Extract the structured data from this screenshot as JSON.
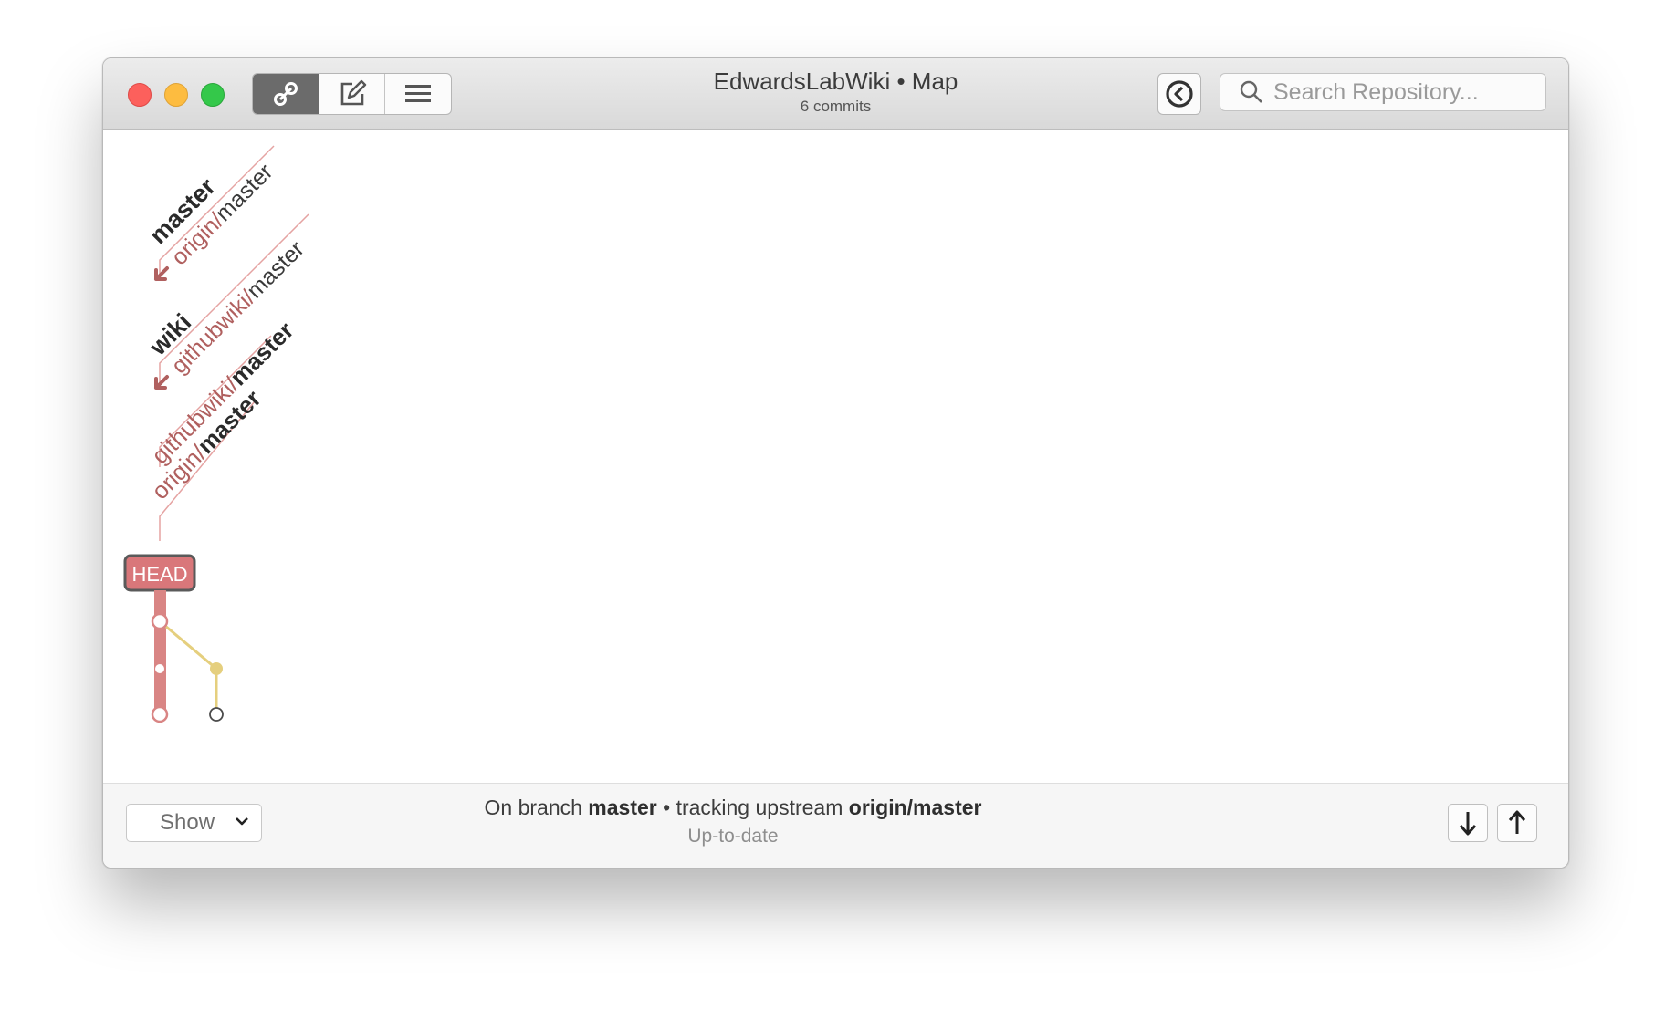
{
  "window": {
    "title": "EdwardsLabWiki • Map",
    "subtitle": "6 commits"
  },
  "toolbar": {
    "segments": [
      {
        "icon": "map-icon",
        "active": true
      },
      {
        "icon": "compose-icon",
        "active": false
      },
      {
        "icon": "list-icon",
        "active": false
      }
    ],
    "history_icon": "back-arrow-icon",
    "search_placeholder": "Search Repository..."
  },
  "map": {
    "ref_groups": [
      {
        "local": "master",
        "remote_prefix": "origin/",
        "remote_name": "master",
        "remote_tracking": true
      },
      {
        "local": "wiki",
        "remote_prefix": "githubwiki/",
        "remote_name": "master",
        "remote_tracking": true
      },
      {
        "remote_prefix": "githubwiki/",
        "remote_name": "master",
        "bold": true
      },
      {
        "remote_prefix": "origin/",
        "remote_name": "master",
        "bold": true
      }
    ],
    "head_label": "HEAD",
    "colors": {
      "main_branch": "#d98584",
      "side_branch": "#e5cf7e",
      "remote_text": "#b0605f",
      "head_badge": "#d9777a"
    }
  },
  "footer": {
    "show_label": "Show",
    "status_prefix": "On branch ",
    "branch": "master",
    "status_mid": " • tracking upstream ",
    "upstream": "origin/master",
    "sync_status": "Up-to-date",
    "fetch_icon": "down-arrow-icon",
    "push_icon": "up-arrow-icon"
  }
}
